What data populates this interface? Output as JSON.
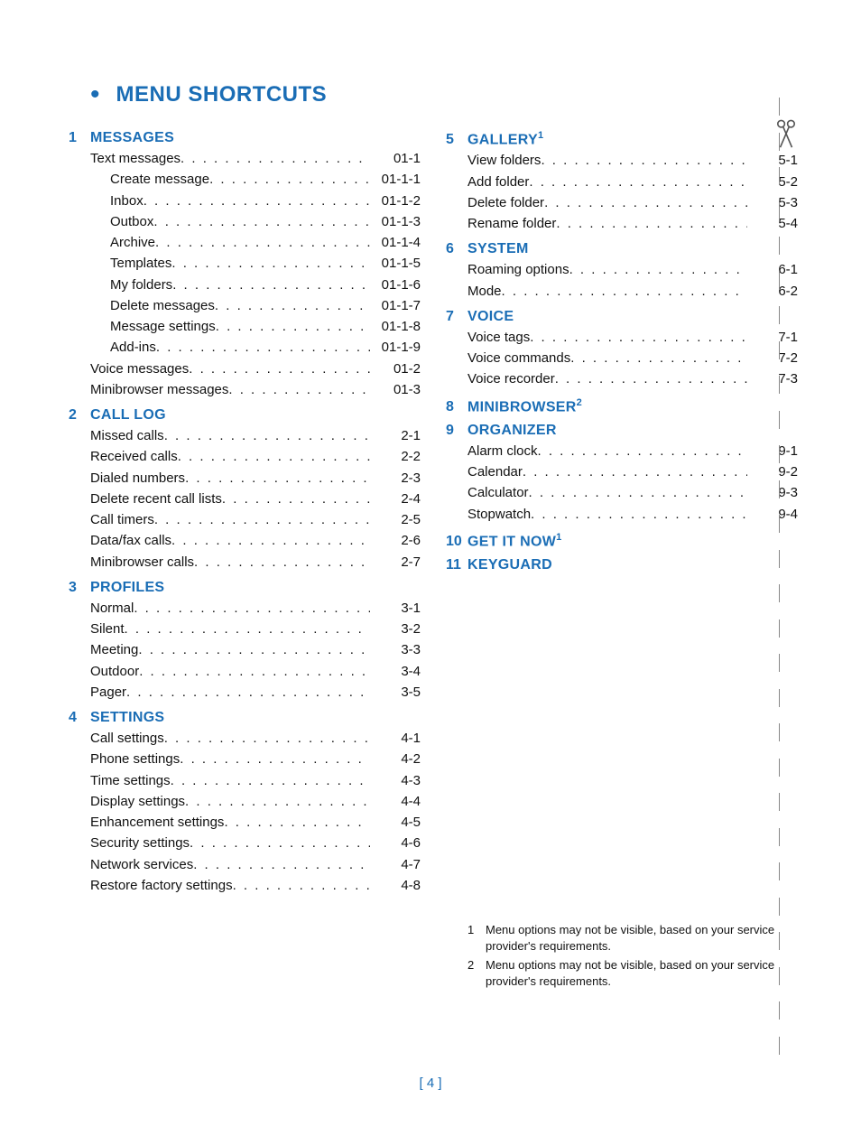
{
  "title": "MENU SHORTCUTS",
  "page_number": "[ 4 ]",
  "columns": [
    {
      "sections": [
        {
          "num": "1",
          "title": "MESSAGES",
          "footnote": null,
          "items": [
            {
              "label": "Text messages",
              "code": "01-1",
              "indent": 1
            },
            {
              "label": "Create message",
              "code": "01-1-1",
              "indent": 2
            },
            {
              "label": "Inbox",
              "code": "01-1-2",
              "indent": 2
            },
            {
              "label": "Outbox",
              "code": "01-1-3",
              "indent": 2
            },
            {
              "label": "Archive",
              "code": "01-1-4",
              "indent": 2
            },
            {
              "label": "Templates",
              "code": "01-1-5",
              "indent": 2
            },
            {
              "label": "My folders",
              "code": "01-1-6",
              "indent": 2
            },
            {
              "label": "Delete messages",
              "code": "01-1-7",
              "indent": 2
            },
            {
              "label": "Message settings",
              "code": "01-1-8",
              "indent": 2
            },
            {
              "label": "Add-ins",
              "code": "01-1-9",
              "indent": 2
            },
            {
              "label": "Voice messages",
              "code": "01-2",
              "indent": 1
            },
            {
              "label": "Minibrowser messages",
              "code": "01-3",
              "indent": 1
            }
          ]
        },
        {
          "num": "2",
          "title": "CALL LOG",
          "footnote": null,
          "items": [
            {
              "label": "Missed calls",
              "code": "2-1",
              "indent": 1
            },
            {
              "label": "Received calls",
              "code": "2-2",
              "indent": 1
            },
            {
              "label": "Dialed numbers",
              "code": "2-3",
              "indent": 1
            },
            {
              "label": "Delete recent call lists",
              "code": "2-4",
              "indent": 1
            },
            {
              "label": "Call timers",
              "code": "2-5",
              "indent": 1
            },
            {
              "label": "Data/fax calls",
              "code": "2-6",
              "indent": 1
            },
            {
              "label": "Minibrowser calls",
              "code": "2-7",
              "indent": 1
            }
          ]
        },
        {
          "num": "3",
          "title": "PROFILES",
          "footnote": null,
          "items": [
            {
              "label": "Normal",
              "code": "3-1",
              "indent": 1
            },
            {
              "label": "Silent",
              "code": "3-2",
              "indent": 1
            },
            {
              "label": "Meeting",
              "code": "3-3",
              "indent": 1
            },
            {
              "label": "Outdoor",
              "code": "3-4",
              "indent": 1
            },
            {
              "label": "Pager",
              "code": "3-5",
              "indent": 1
            }
          ]
        },
        {
          "num": "4",
          "title": "SETTINGS",
          "footnote": null,
          "items": [
            {
              "label": "Call settings",
              "code": "4-1",
              "indent": 1
            },
            {
              "label": "Phone settings",
              "code": "4-2",
              "indent": 1
            },
            {
              "label": "Time settings",
              "code": "4-3",
              "indent": 1
            },
            {
              "label": "Display settings",
              "code": "4-4",
              "indent": 1
            },
            {
              "label": "Enhancement settings",
              "code": "4-5",
              "indent": 1
            },
            {
              "label": "Security settings",
              "code": "4-6",
              "indent": 1
            },
            {
              "label": "Network services",
              "code": "4-7",
              "indent": 1
            },
            {
              "label": "Restore factory settings",
              "code": "4-8",
              "indent": 1
            }
          ]
        }
      ]
    },
    {
      "sections": [
        {
          "num": "5",
          "title": "GALLERY",
          "footnote": "1",
          "items": [
            {
              "label": "View folders",
              "code": "5-1",
              "indent": 1
            },
            {
              "label": "Add folder",
              "code": "5-2",
              "indent": 1
            },
            {
              "label": "Delete folder",
              "code": "5-3",
              "indent": 1
            },
            {
              "label": "Rename folder",
              "code": "5-4",
              "indent": 1
            }
          ]
        },
        {
          "num": "6",
          "title": "SYSTEM",
          "footnote": null,
          "items": [
            {
              "label": "Roaming options",
              "code": "6-1",
              "indent": 1
            },
            {
              "label": "Mode",
              "code": "6-2",
              "indent": 1
            }
          ]
        },
        {
          "num": "7",
          "title": "VOICE",
          "footnote": null,
          "items": [
            {
              "label": "Voice tags",
              "code": "7-1",
              "indent": 1
            },
            {
              "label": "Voice commands",
              "code": "7-2",
              "indent": 1
            },
            {
              "label": "Voice recorder",
              "code": "7-3",
              "indent": 1
            }
          ]
        },
        {
          "num": "8",
          "title": "MINIBROWSER",
          "footnote": "2",
          "items": []
        },
        {
          "num": "9",
          "title": "ORGANIZER",
          "footnote": null,
          "items": [
            {
              "label": "Alarm clock",
              "code": "9-1",
              "indent": 1
            },
            {
              "label": "Calendar",
              "code": "9-2",
              "indent": 1
            },
            {
              "label": "Calculator",
              "code": "9-3",
              "indent": 1
            },
            {
              "label": "Stopwatch",
              "code": "9-4",
              "indent": 1
            }
          ]
        },
        {
          "num": "10",
          "title": "GET IT NOW",
          "footnote": "1",
          "items": []
        },
        {
          "num": "11",
          "title": "KEYGUARD",
          "footnote": null,
          "items": []
        }
      ],
      "footnotes": [
        {
          "num": "1",
          "text": "Menu options may not be visible, based on your service provider's requirements."
        },
        {
          "num": "2",
          "text": "Menu options may not be visible, based on your service provider's requirements."
        }
      ]
    }
  ]
}
